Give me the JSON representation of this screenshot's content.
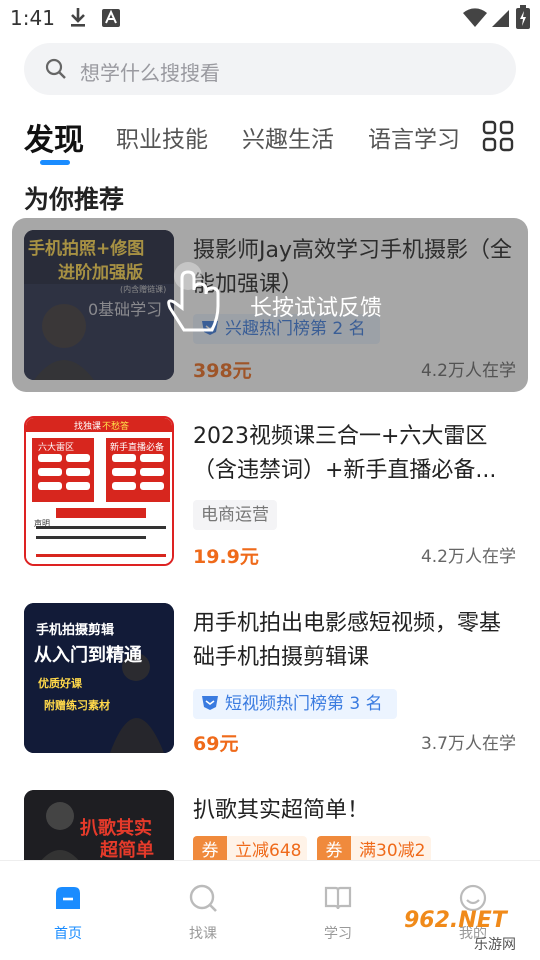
{
  "status_bar": {
    "time": "1:41",
    "icons": [
      "download-icon",
      "font-icon",
      "wifi-icon",
      "battery-icon"
    ]
  },
  "search": {
    "placeholder": "想学什么搜搜看"
  },
  "tabs": [
    {
      "label": "发现",
      "active": true
    },
    {
      "label": "职业技能"
    },
    {
      "label": "兴趣生活"
    },
    {
      "label": "语言学习"
    }
  ],
  "section_title": "为你推荐",
  "overlay": {
    "hint": "长按试试反馈"
  },
  "courses": [
    {
      "title": "摄影师Jay高效学习手机摄影（全能加强课）",
      "badge": "兴趣热门榜第 2 名",
      "price": "398元",
      "learners": "4.2万人在学",
      "thumb_text": [
        "手机拍照+修图",
        "进阶加强版",
        "(内含赠链课)",
        "0基础学习"
      ]
    },
    {
      "title": "2023视频课三合一+六大雷区（含违禁词）+新手直播必备...",
      "tag": "电商运营",
      "price": "19.9元",
      "learners": "4.2万人在学",
      "thumb_text": [
        "找独课",
        "不愁答",
        "六大雷区",
        "新手直播必备",
        "声明"
      ]
    },
    {
      "title": "用手机拍出电影感短视频，零基础手机拍摄剪辑课",
      "badge": "短视频热门榜第 3 名",
      "price": "69元",
      "learners": "3.7万人在学",
      "thumb_text": [
        "手机拍摄剪辑",
        "从入门到精通",
        "优质好课",
        "附赠练习素材"
      ]
    },
    {
      "title": "扒歌其实超简单！",
      "coupons": [
        {
          "tag": "券",
          "text": "立减648"
        },
        {
          "tag": "券",
          "text": "满30减2"
        }
      ],
      "thumb_text": [
        "扒歌其实",
        "超简单"
      ]
    }
  ],
  "bottom_nav": [
    {
      "label": "首页",
      "icon": "home-icon",
      "active": true
    },
    {
      "label": "找课",
      "icon": "search-icon"
    },
    {
      "label": "学习",
      "icon": "book-icon"
    },
    {
      "label": "我的",
      "icon": "profile-icon"
    }
  ],
  "watermark": {
    "text": "962.NET",
    "sub": "乐游网"
  },
  "colors": {
    "accent": "#1a8cff",
    "price": "#ef6a1a",
    "badge_bg": "#ecf4ff"
  }
}
